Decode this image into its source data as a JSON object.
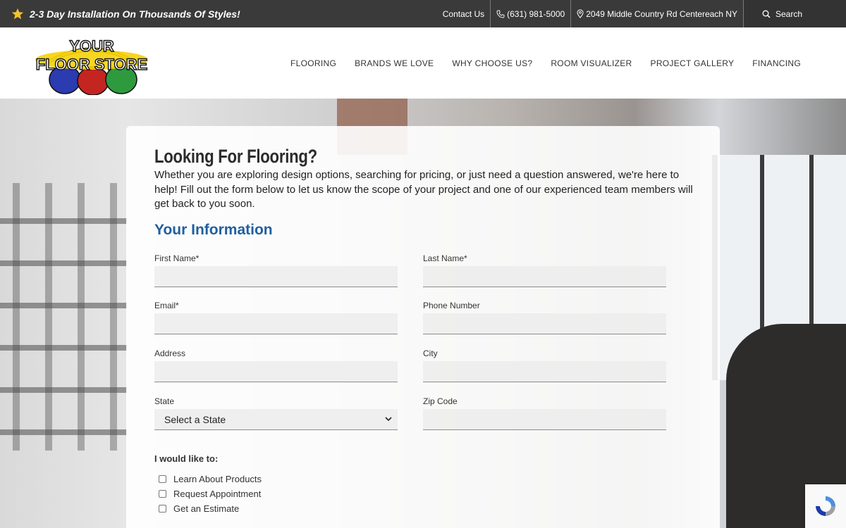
{
  "topbar": {
    "promo": "2-3 Day Installation On Thousands Of Styles!",
    "contact": "Contact Us",
    "phone": "(631) 981-5000",
    "address": "2049 Middle Country Rd Centereach NY",
    "search": "Search"
  },
  "logo": {
    "line1": "YOUR",
    "line2": "FLOOR STORE"
  },
  "nav": [
    "FLOORING",
    "BRANDS WE LOVE",
    "WHY CHOOSE US?",
    "ROOM VISUALIZER",
    "PROJECT GALLERY",
    "FINANCING"
  ],
  "form": {
    "title": "Looking For Flooring?",
    "intro": "Whether you are exploring design options, searching for pricing, or just need a question answered, we're here to help! Fill out the form below to let us know the scope of your project and one of our experienced team members will get back to you soon.",
    "section": "Your Information",
    "fields": {
      "first_name": "First Name*",
      "last_name": "Last Name*",
      "email": "Email*",
      "phone": "Phone Number",
      "address": "Address",
      "city": "City",
      "state": "State",
      "zip": "Zip Code"
    },
    "state_selected": "Select a State",
    "like_title": "I would like to:",
    "options": [
      "Learn About Products",
      "Request Appointment",
      "Get an Estimate"
    ]
  },
  "colors": {
    "topbar": "#3a3a3a",
    "section_title": "#1f5f9e",
    "star": "#f2c230"
  }
}
